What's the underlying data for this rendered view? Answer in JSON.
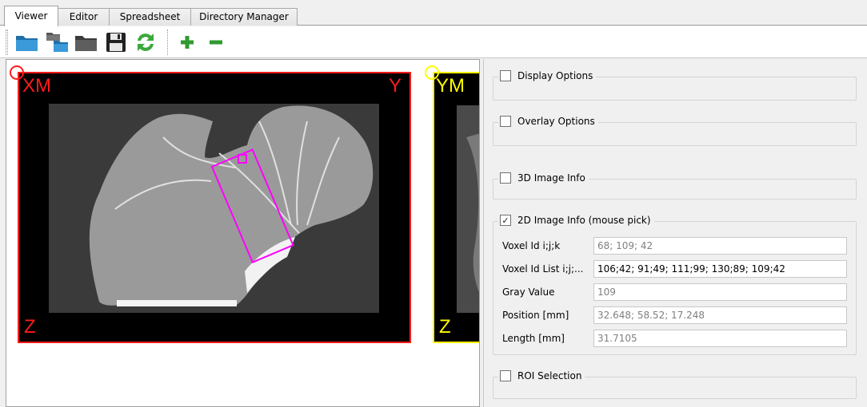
{
  "tabs": [
    {
      "label": "Viewer",
      "active": true
    },
    {
      "label": "Editor",
      "active": false
    },
    {
      "label": "Spreadsheet",
      "active": false
    },
    {
      "label": "Directory Manager",
      "active": false
    }
  ],
  "toolbar": {
    "icons": [
      "open-folder-icon",
      "open-series-icon",
      "close-folder-icon",
      "save-icon",
      "refresh-icon",
      "plus-icon",
      "minus-icon"
    ]
  },
  "viewer": {
    "xm": {
      "top_left": "XM",
      "top_right": "Y",
      "bottom_left": "Z",
      "border_color": "#ff1a1a"
    },
    "ym": {
      "top_left": "YM",
      "bottom_left": "Z",
      "border_color": "#ffff00"
    },
    "roi_color": "#ff00ff"
  },
  "panel": {
    "display_options": {
      "label": "Display Options",
      "checked": false
    },
    "overlay_options": {
      "label": "Overlay Options",
      "checked": false
    },
    "image3d_info": {
      "label": "3D Image Info",
      "checked": false
    },
    "image2d_info": {
      "label": "2D Image Info (mouse pick)",
      "checked": true,
      "fields": [
        {
          "label": "Voxel Id  i;j;k",
          "value": "68; 109; 42"
        },
        {
          "label": "Voxel Id List  i;j;...",
          "value": "106;42; 91;49; 111;99; 130;89; 109;42"
        },
        {
          "label": "Gray Value",
          "value": "109"
        },
        {
          "label": "Position  [mm]",
          "value": "32.648; 58.52; 17.248"
        },
        {
          "label": "Length  [mm]",
          "value": "31.7105"
        }
      ]
    },
    "roi_selection": {
      "label": "ROI Selection",
      "checked": false
    }
  }
}
